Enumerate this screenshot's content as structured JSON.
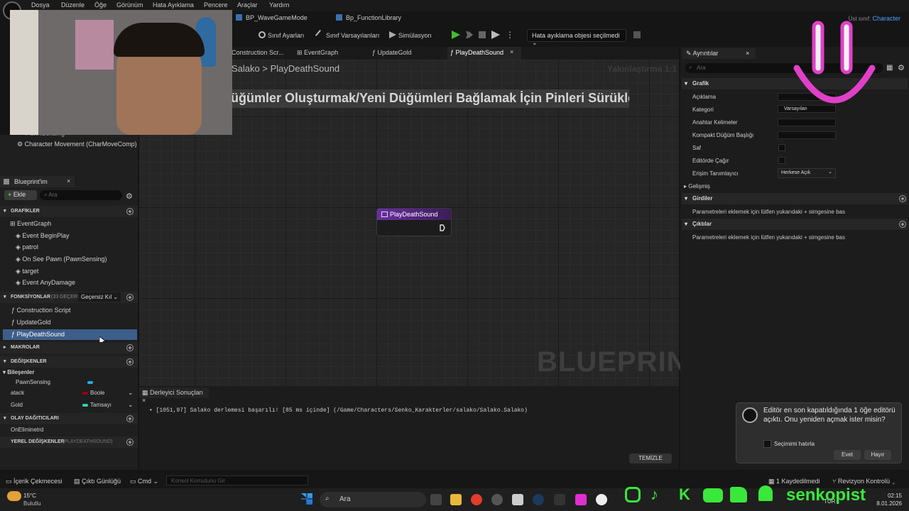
{
  "menu": [
    "Dosya",
    "Düzenle",
    "Öğe",
    "Görünüm",
    "Hata Ayıklama",
    "Pencere",
    "Araçlar",
    "Yardım"
  ],
  "asset_tabs": [
    "BP_WaveGameMode",
    "Bp_FunctionLibrary"
  ],
  "parent_class": {
    "label": "Üst sınıf:",
    "value": "Character"
  },
  "toolbar": {
    "class_settings": "Sınıf Ayarları",
    "class_defaults": "Sınıf Varsayılanları",
    "simulation": "Simülasyon",
    "debug_object": "Hata ayıklama objesi seçilmedi"
  },
  "graph_tabs": [
    "Construction Scr...",
    "EventGraph",
    "UpdateGold",
    "PlayDeathSound"
  ],
  "breadcrumb": {
    "root": "Salako",
    "sep": ">",
    "current": "PlayDeathSound"
  },
  "zoom": "Yakınlaştırma 1:1",
  "hint_banner": "Düğümler Oluşturmak/Yeni Düğümleri Bağlamak İçin Pinleri Sürükle",
  "node_title": "PlayDeathSound",
  "watermark": "BLUEPRINT",
  "components": {
    "partial_item": "PawnSensing",
    "character_movement": "Character Movement (CharMoveComp)"
  },
  "blueprint_panel": {
    "tab": "Blueprint'im",
    "add": "Ekle",
    "search_placeholder": "Ara",
    "graphs": {
      "title": "GRAFİKLER",
      "event_graph": "EventGraph",
      "events": [
        "Event BeginPlay",
        "patrol",
        "On See Pawn (PawnSensing)",
        "target",
        "Event AnyDamage"
      ]
    },
    "functions": {
      "title": "FONKSİYONLAR",
      "count": "(33 GEÇERSİZ",
      "override": "Geçersiz Kıl",
      "items": [
        "Construction Script",
        "UpdateGold",
        "PlayDeathSound"
      ]
    },
    "macros": "MAKROLAR",
    "variables": {
      "title": "DEĞİŞKENLER",
      "components": "Bileşenler",
      "items": [
        {
          "name": "PawnSensing",
          "type": "",
          "color": "#2aa9e0"
        },
        {
          "name": "atack",
          "type": "Boole",
          "color": "#a10000"
        },
        {
          "name": "Gold",
          "type": "Tamsayı",
          "color": "#21d8b5"
        }
      ]
    },
    "dispatchers": {
      "title": "OLAY DAĞITICILARI",
      "items": [
        "OnEliminetrd"
      ]
    },
    "locals": {
      "title": "YEREL DEĞİŞKENLER",
      "sub": "(PLAYDEATHSOUND)"
    }
  },
  "compiler": {
    "tab": "Derleyici Sonuçları",
    "message": "[1051,97] Salako derlemesi başarılı! [85 ms içinde] (/Game/Characters/Senko_Karakterler/salako/Salako.Salako)",
    "clear": "TEMİZLE"
  },
  "details": {
    "tab": "Ayrıntılar",
    "search_placeholder": "Ara",
    "graph_section": "Grafik",
    "props": {
      "description": "Açıklama",
      "category": "Kategori",
      "category_value": "Varsayılan",
      "keywords": "Anahtar Kelimeler",
      "compact_title": "Kompakt Düğüm Başlığı",
      "pure": "Saf",
      "call_in_editor": "Editörde Çağır",
      "access": "Erişim Tanımlayıcı",
      "access_value": "Herkese Açık"
    },
    "advanced": "Gelişmiş",
    "inputs": "Girdiler",
    "inputs_hint": "Parametreleri eklemek için lütfen yukarıdaki + simgesine bas",
    "outputs": "Çıktılar",
    "outputs_hint": "Parametreleri eklemek için lütfen yukarıdaki + simgesine bas"
  },
  "statusbar": {
    "content_drawer": "İçerik Çekmecesi",
    "output_log": "Çıktı Günlüğü",
    "cmd": "Cmd",
    "cmd_placeholder": "Konsol Komutunu Gir",
    "saved": "1 Kaydedilmedi",
    "revision": "Revizyon Kontrolü"
  },
  "notification": {
    "message": "Editör en son kapatıldığında 1 öğe editörü açıktı. Onu yeniden açmak ister misin?",
    "remember": "Seçimimi hatırla",
    "yes": "Evet",
    "no": "Hayır"
  },
  "taskbar": {
    "weather_temp": "15°C",
    "weather_desc": "Bulutlu",
    "search": "Ara",
    "lang": "TUR",
    "time": "02:15",
    "date": "8.01.2026"
  },
  "social": {
    "handle": "senkopist"
  }
}
